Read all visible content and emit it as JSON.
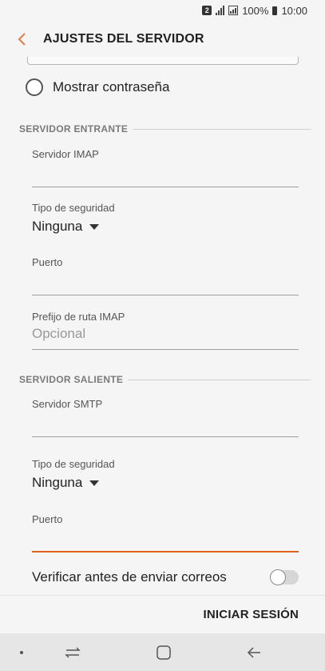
{
  "status_bar": {
    "sim_badge": "2",
    "battery": "100%",
    "time": "10:00"
  },
  "header": {
    "title": "AJUSTES DEL SERVIDOR"
  },
  "password": {
    "show_password_label": "Mostrar contraseña"
  },
  "incoming": {
    "section_title": "SERVIDOR ENTRANTE",
    "server_label": "Servidor IMAP",
    "server_value": "",
    "security_label": "Tipo de seguridad",
    "security_value": "Ninguna",
    "port_label": "Puerto",
    "port_value": "",
    "prefix_label": "Prefijo de ruta IMAP",
    "prefix_placeholder": "Opcional"
  },
  "outgoing": {
    "section_title": "SERVIDOR SALIENTE",
    "server_label": "Servidor SMTP",
    "server_value": "",
    "security_label": "Tipo de seguridad",
    "security_value": "Ninguna",
    "port_label": "Puerto",
    "port_value": ""
  },
  "verify": {
    "label": "Verificar antes de enviar correos",
    "enabled": false
  },
  "actions": {
    "login_label": "INICIAR SESIÓN"
  },
  "colors": {
    "accent": "#e0601e",
    "back_arrow": "#e07d4f"
  }
}
